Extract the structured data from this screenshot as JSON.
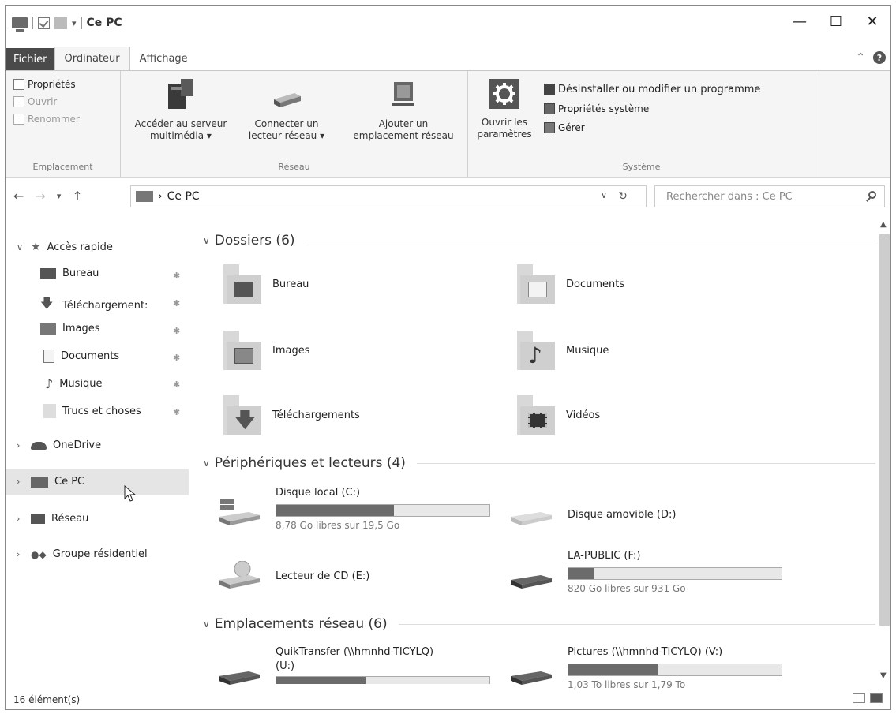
{
  "titlebar": {
    "title": "Ce PC",
    "minimize": "—",
    "maximize": "☐",
    "close": "✕"
  },
  "tabs": {
    "file": "Fichier",
    "computer": "Ordinateur",
    "view": "Affichage"
  },
  "ribbon": {
    "location": {
      "label": "Emplacement",
      "properties": "Propriétés",
      "open": "Ouvrir",
      "rename": "Renommer"
    },
    "network": {
      "label": "Réseau",
      "media_server_line1": "Accéder au serveur",
      "media_server_line2": "multimédia ▾",
      "map_drive_line1": "Connecter un",
      "map_drive_line2": "lecteur réseau ▾",
      "add_location_line1": "Ajouter un",
      "add_location_line2": "emplacement réseau"
    },
    "system": {
      "label": "Système",
      "open_settings_line1": "Ouvrir les",
      "open_settings_line2": "paramètres",
      "uninstall": "Désinstaller ou modifier un programme",
      "system_properties": "Propriétés système",
      "manage": "Gérer"
    }
  },
  "address": {
    "path": "Ce PC",
    "search_placeholder": "Rechercher dans : Ce PC"
  },
  "nav": {
    "quick_access": "Accès rapide",
    "quick_items": [
      {
        "label": "Bureau",
        "icon": "desktop-icon"
      },
      {
        "label": "Téléchargement:",
        "icon": "download-icon"
      },
      {
        "label": "Images",
        "icon": "images-icon"
      },
      {
        "label": "Documents",
        "icon": "documents-icon"
      },
      {
        "label": "Musique",
        "icon": "music-icon"
      },
      {
        "label": "Trucs et choses",
        "icon": "folder-icon"
      }
    ],
    "onedrive": "OneDrive",
    "this_pc": "Ce PC",
    "network": "Réseau",
    "homegroup": "Groupe résidentiel"
  },
  "sections": {
    "folders": "Dossiers (6)",
    "devices": "Périphériques et lecteurs (4)",
    "network": "Emplacements réseau (6)"
  },
  "folders": [
    {
      "label": "Bureau",
      "icon": "desktop-folder-icon"
    },
    {
      "label": "Documents",
      "icon": "documents-folder-icon"
    },
    {
      "label": "Images",
      "icon": "images-folder-icon"
    },
    {
      "label": "Musique",
      "icon": "music-folder-icon"
    },
    {
      "label": "Téléchargements",
      "icon": "downloads-folder-icon"
    },
    {
      "label": "Vidéos",
      "icon": "videos-folder-icon"
    }
  ],
  "drives": [
    {
      "name": "Disque local (C:)",
      "free": "8,78 Go libres sur 19,5 Go",
      "used_fraction": 0.55
    },
    {
      "name": "Disque amovible (D:)"
    },
    {
      "name": "Lecteur de CD (E:)"
    },
    {
      "name": "LA-PUBLIC (F:)",
      "free": "820 Go libres sur 931 Go",
      "used_fraction": 0.12
    }
  ],
  "network_locations": [
    {
      "name_line1": "QuikTransfer (\\\\hmnhd-TICYLQ)",
      "name_line2": "(U:)",
      "used_fraction": 0.42
    },
    {
      "name": "Pictures (\\\\hmnhd-TICYLQ) (V:)",
      "free": "1,03 To libres sur 1,79 To",
      "used_fraction": 0.42
    }
  ],
  "status": {
    "count": "16 élément(s)"
  }
}
